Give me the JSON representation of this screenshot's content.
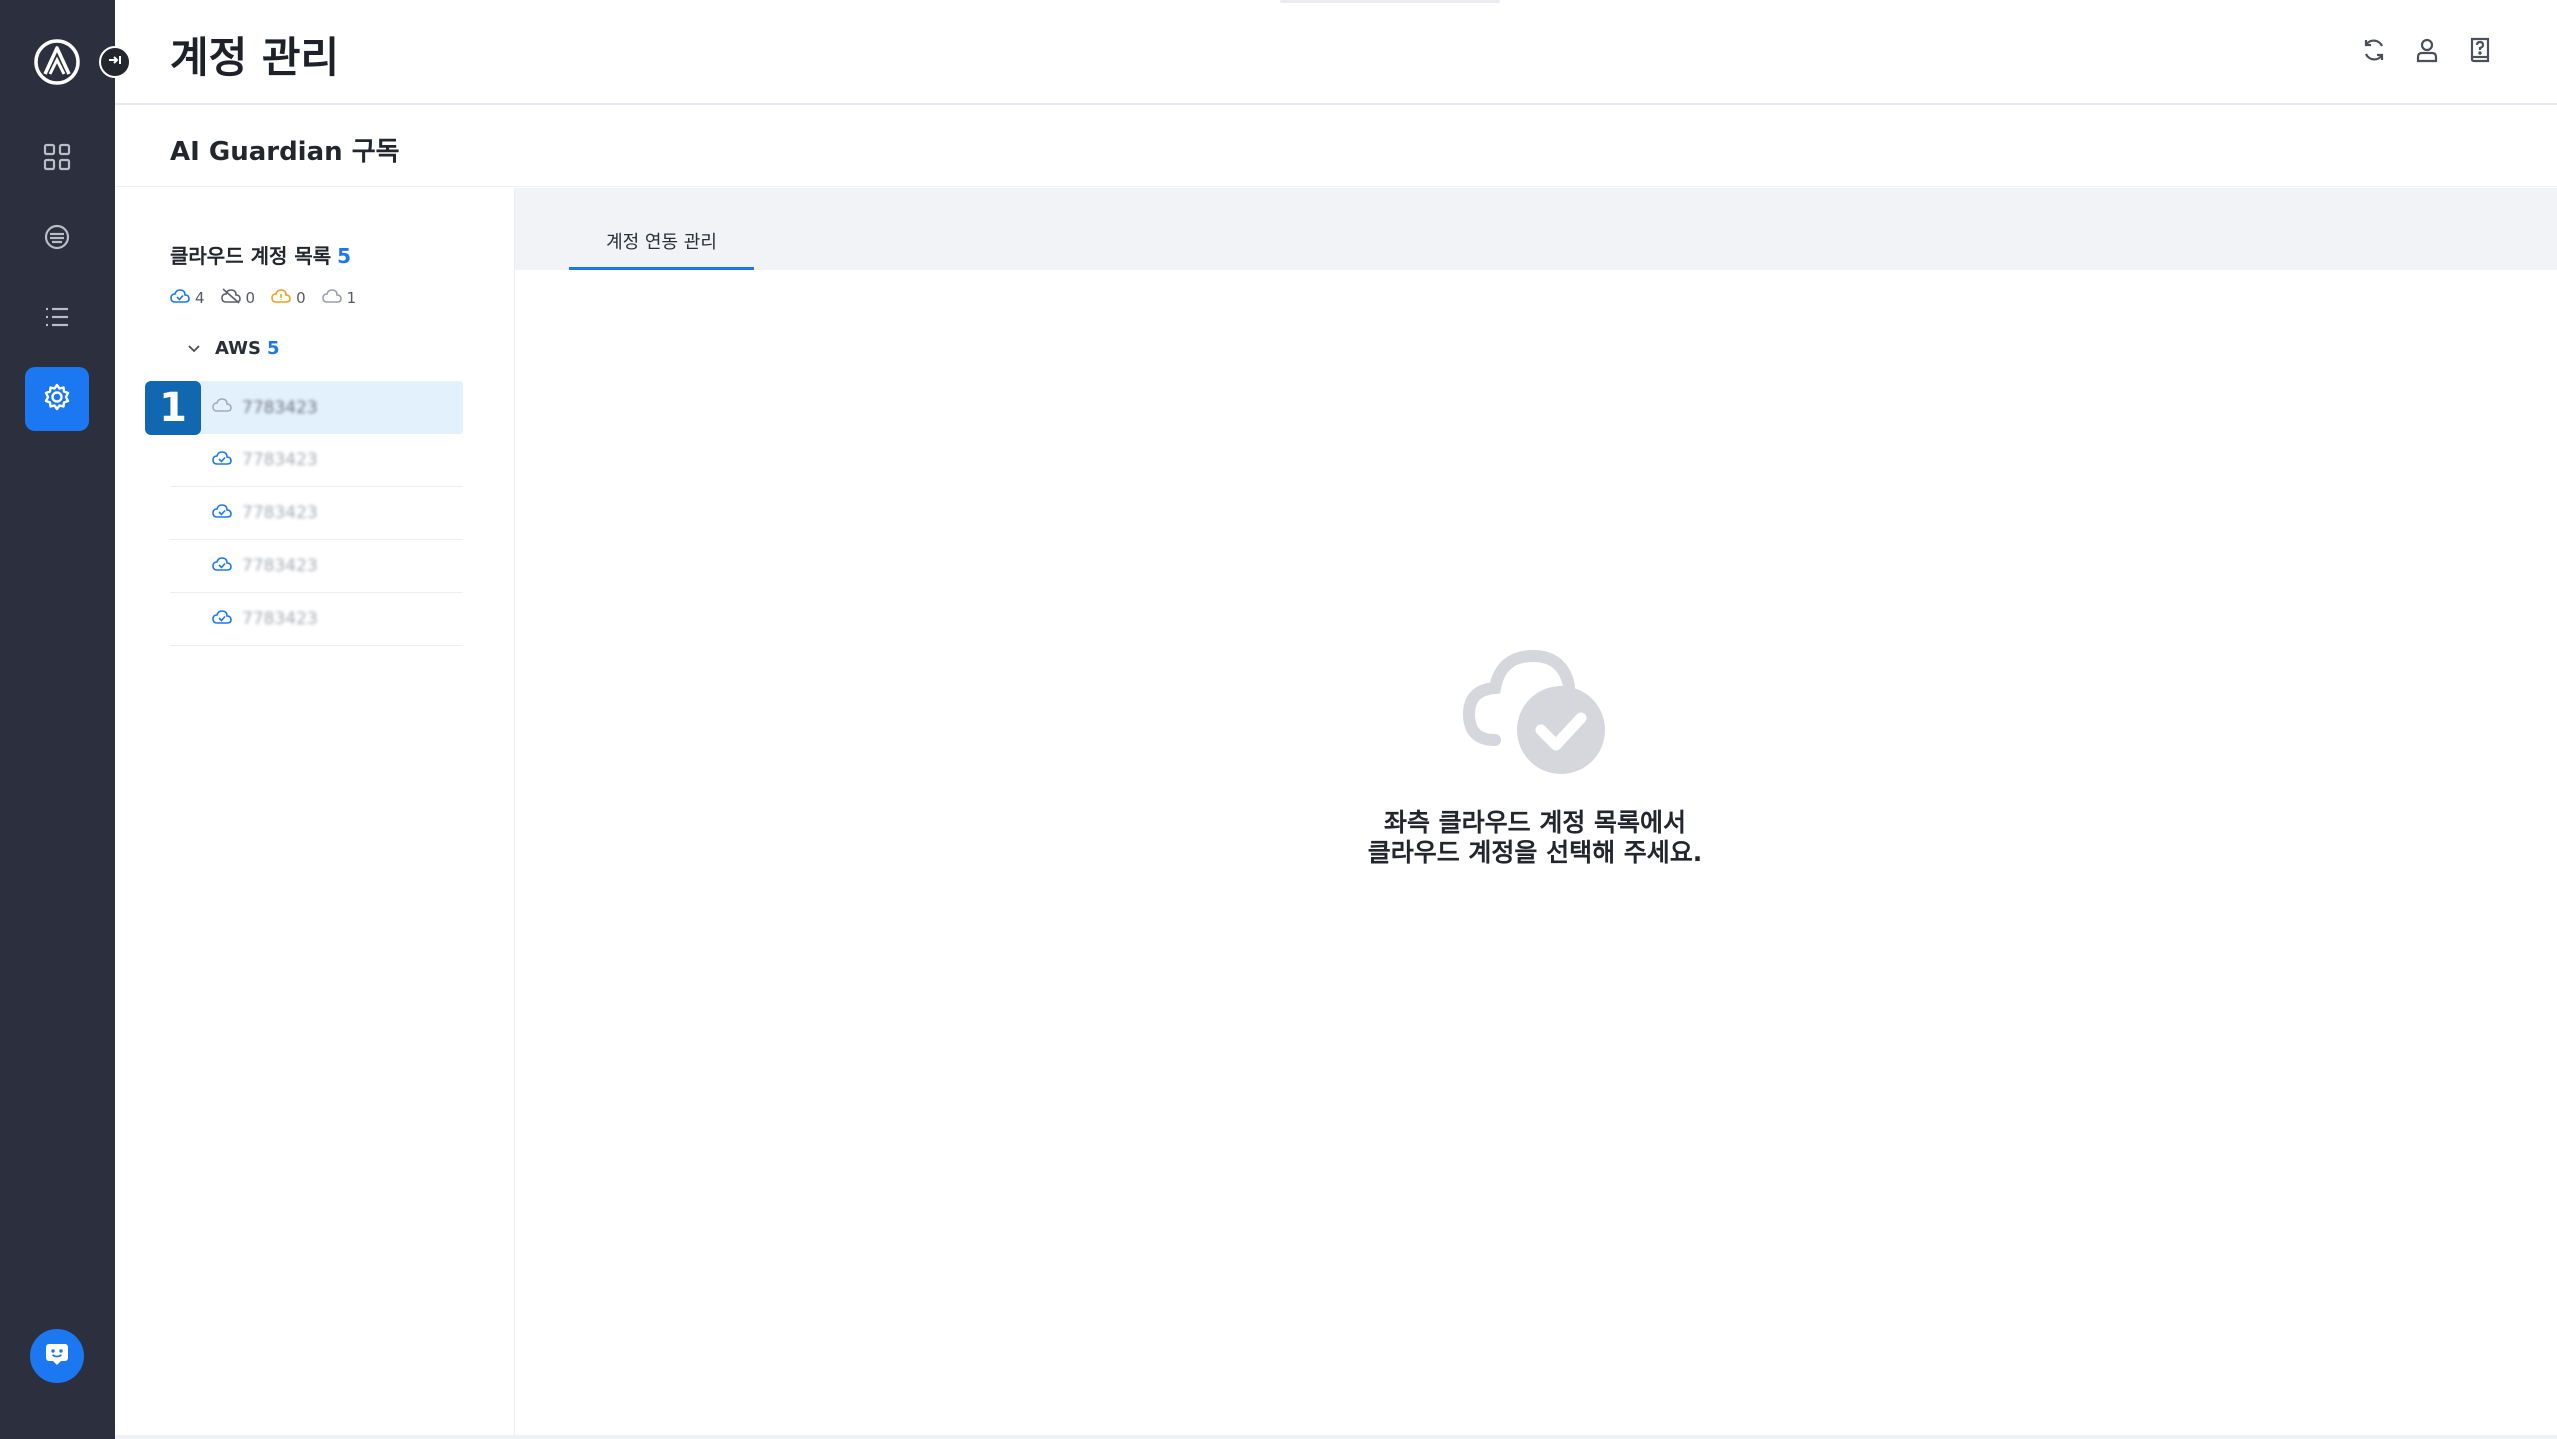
{
  "app": {
    "accent": "#1c78f0",
    "nav_bg": "#2c2f3d"
  },
  "header": {
    "title": "계정 관리"
  },
  "subheader": {
    "title": "AI Guardian 구독"
  },
  "account_list": {
    "title": "클라우드 계정 목록",
    "count": "5",
    "status_counts": [
      {
        "icon": "cloud-connected-icon",
        "value": "4"
      },
      {
        "icon": "cloud-disconnected-icon",
        "value": "0"
      },
      {
        "icon": "cloud-warning-icon",
        "value": "0"
      },
      {
        "icon": "cloud-empty-icon",
        "value": "1"
      }
    ],
    "groups": [
      {
        "name": "AWS",
        "count": "5",
        "accounts": [
          {
            "id": "7783423",
            "status": "cloud-empty-icon",
            "selected": true
          },
          {
            "id": "7783423",
            "status": "cloud-connected-icon",
            "selected": false
          },
          {
            "id": "7783423",
            "status": "cloud-connected-icon",
            "selected": false
          },
          {
            "id": "7783423",
            "status": "cloud-connected-icon",
            "selected": false
          },
          {
            "id": "7783423",
            "status": "cloud-connected-icon",
            "selected": false
          }
        ]
      }
    ]
  },
  "step_badge": "1",
  "tabs": [
    {
      "label": "계정 연동 관리"
    }
  ],
  "empty_state": {
    "line1": "좌측 클라우드 계정 목록에서",
    "line2": "클라우드 계정을 선택해 주세요."
  }
}
